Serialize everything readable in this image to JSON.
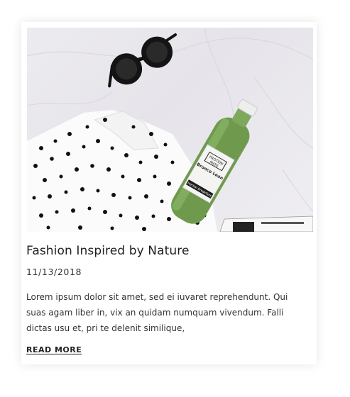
{
  "post": {
    "title": "Fashion Inspired by Nature",
    "date": "11/13/2018",
    "excerpt": "Lorem ipsum dolor sit amet, sed ei iuvaret reprehendunt. Qui suas agam liber in, vix an quidam numquam vivendum. Falli dictas usu et, pri te delenit similique,",
    "read_more_label": "READ MORE"
  },
  "photo": {
    "bottle_label_line1": "PROTEIN",
    "bottle_label_line2": "MATE",
    "bottle_label_line3": "Bronco Lean",
    "bottle_label_line4": "Herbal Breakfast"
  }
}
